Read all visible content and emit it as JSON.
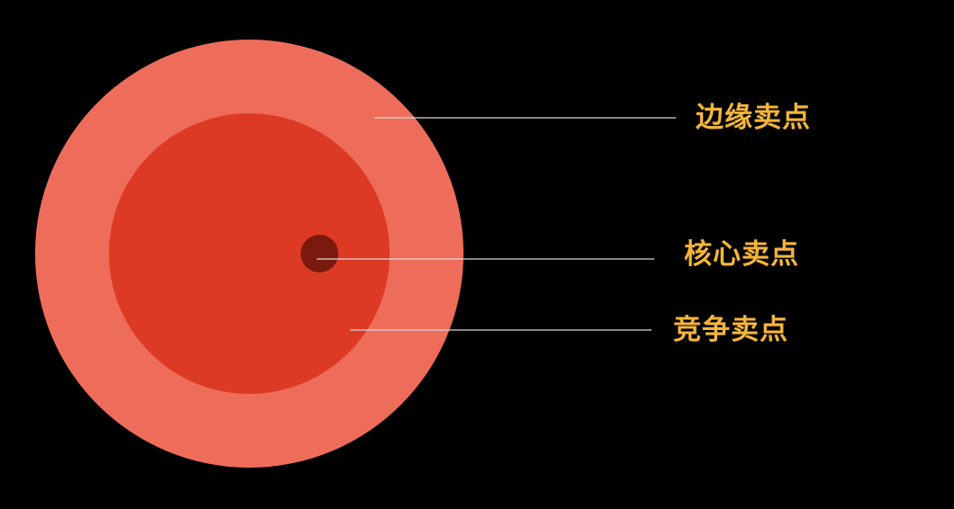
{
  "diagram": {
    "labels": {
      "edge": "边缘卖点",
      "core": "核心卖点",
      "competitive": "竞争卖点"
    }
  },
  "colors": {
    "background": "#000000",
    "outer_ring": "#EE6D5A",
    "inner_circle": "#DD3A26",
    "core_dot": "#7A1A0E",
    "leader_line": "#D9D9D9",
    "label_text": "#F4B53A"
  }
}
